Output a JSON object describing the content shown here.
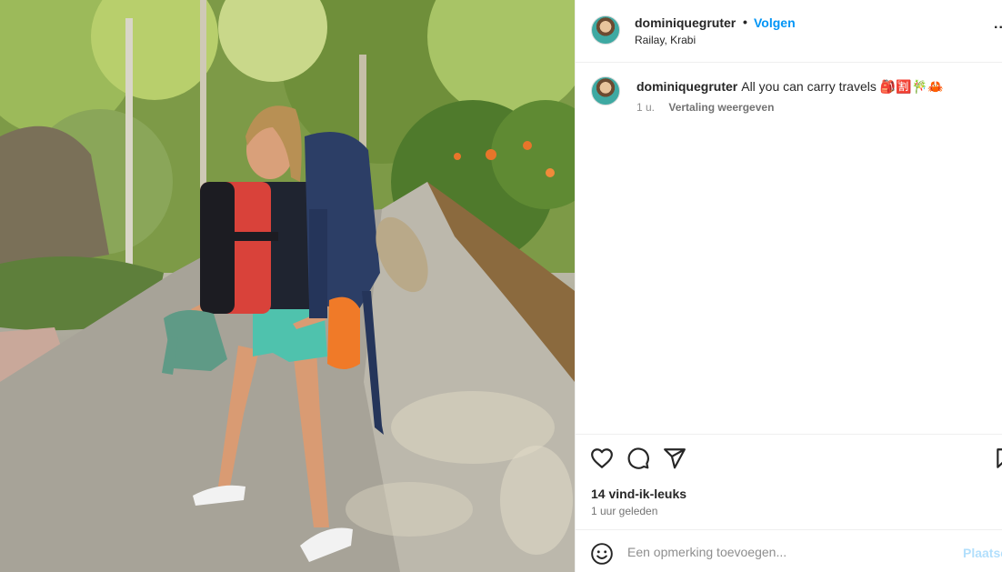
{
  "post": {
    "username": "dominiquegruter",
    "follow_label": "Volgen",
    "separator": "•",
    "location": "Railay, Krabi",
    "more_label": "..."
  },
  "caption": {
    "username": "dominiquegruter",
    "text": "All you can carry travels 🎒🈹🎋🦀",
    "time": "1 u.",
    "translate_label": "Vertaling weergeven"
  },
  "actions": {
    "like_icon": "heart-icon",
    "comment_icon": "comment-icon",
    "share_icon": "send-icon",
    "save_icon": "bookmark-icon",
    "likes_label": "14 vind-ik-leuks",
    "time_ago": "1 uur geleden"
  },
  "comment_box": {
    "placeholder": "Een opmerking toevoegen...",
    "post_label": "Plaatsen",
    "emoji_icon": "smiley-icon"
  },
  "colors": {
    "accent": "#0095f6",
    "post_disabled": "#b2dffc",
    "text": "#262626",
    "muted": "#8e8e8e"
  }
}
